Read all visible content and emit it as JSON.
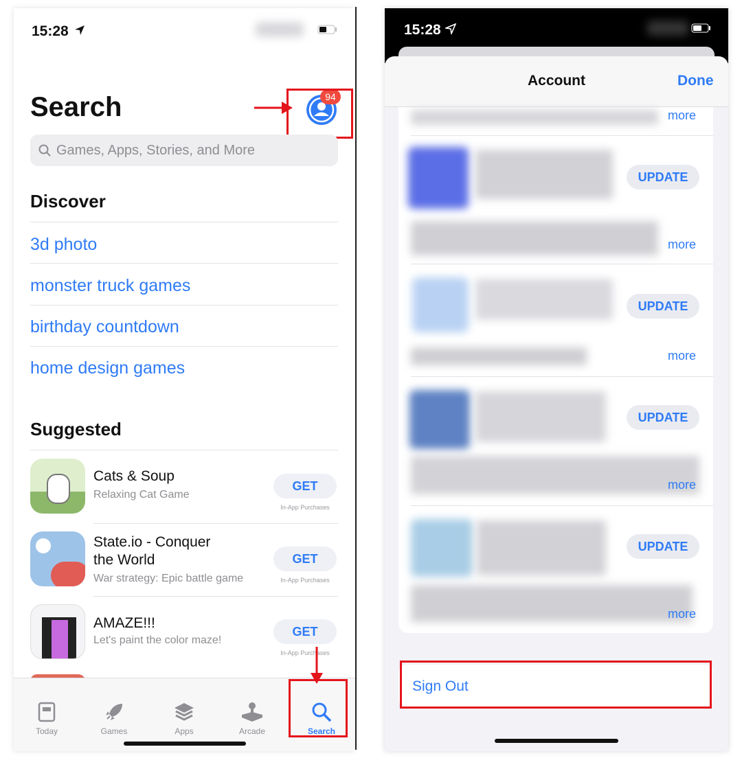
{
  "left": {
    "status_time": "15:28",
    "title": "Search",
    "badge": "94",
    "search_placeholder": "Games, Apps, Stories, and More",
    "discover_heading": "Discover",
    "discover_items": [
      "3d photo",
      "monster truck games",
      "birthday countdown",
      "home design games"
    ],
    "suggested_heading": "Suggested",
    "apps": [
      {
        "name_line1": "Cats & Soup",
        "name_line2": "",
        "subtitle": "Relaxing Cat Game",
        "button": "GET",
        "note": "In-App Purchases"
      },
      {
        "name_line1": "State.io - Conquer",
        "name_line2": "the World",
        "subtitle": "War strategy: Epic battle game",
        "button": "GET",
        "note": "In-App Purchases"
      },
      {
        "name_line1": "AMAZE!!!",
        "name_line2": "",
        "subtitle": "Let's paint the color maze!",
        "button": "GET",
        "note": "In-App Purchases"
      }
    ],
    "tabs": [
      {
        "label": "Today",
        "icon": "today-icon"
      },
      {
        "label": "Games",
        "icon": "rocket-icon"
      },
      {
        "label": "Apps",
        "icon": "layers-icon"
      },
      {
        "label": "Arcade",
        "icon": "joystick-icon"
      },
      {
        "label": "Search",
        "icon": "search-icon"
      }
    ]
  },
  "right": {
    "status_time": "15:28",
    "title": "Account",
    "done": "Done",
    "more_label": "more",
    "update_label": "UPDATE",
    "sign_out": "Sign Out"
  },
  "colors": {
    "accent": "#2f7bf6",
    "annotation": "#e4141b",
    "badge": "#f04a3e"
  }
}
